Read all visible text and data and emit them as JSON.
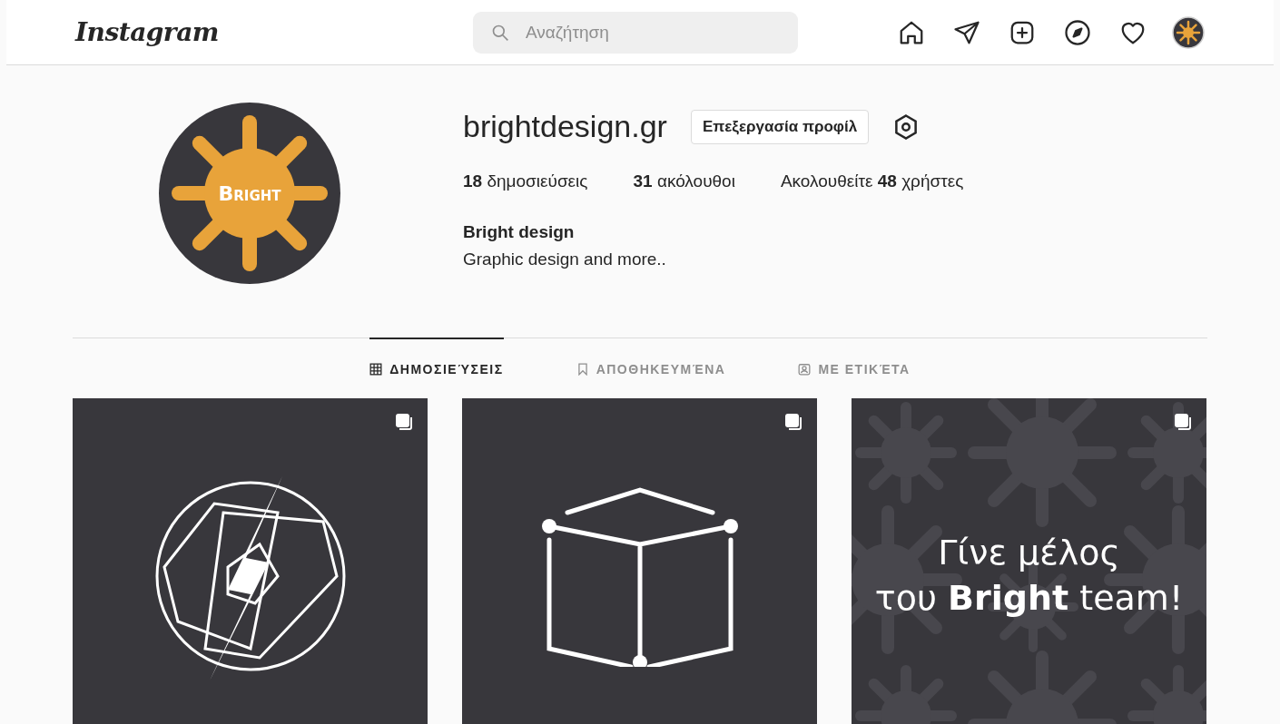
{
  "header": {
    "logo": "Instagram",
    "search": {
      "placeholder": "Αναζήτηση"
    },
    "nav": [
      {
        "kind": "home",
        "selected": false
      },
      {
        "kind": "direct",
        "selected": false
      },
      {
        "kind": "new",
        "selected": false
      },
      {
        "kind": "explore",
        "selected": false
      },
      {
        "kind": "activity",
        "selected": false
      },
      {
        "kind": "avatar",
        "selected": false
      }
    ]
  },
  "profile": {
    "username": "brightdesign.gr",
    "edit_button": "Επεξεργασία προφίλ",
    "avatar_logo": "Bright",
    "stats": [
      {
        "count": "18",
        "label": "δημοσιεύσεις"
      },
      {
        "count": "31",
        "label": "ακόλουθοι"
      },
      {
        "count": "48",
        "label": "χρήστες",
        "prefix": "Ακολουθείτε"
      }
    ],
    "name": "Bright design",
    "bio": "Graphic design and more.."
  },
  "tabs": [
    {
      "kind": "grid",
      "label": "ΔΗΜΟΣΙΕΎΣΕΙΣ",
      "selected": true
    },
    {
      "kind": "saved",
      "label": "ΑΠΟΘΗΚΕΥΜΈΝΑ",
      "selected": false
    },
    {
      "kind": "tagged",
      "label": "ΜΕ ΕΤΙΚΈΤΑ",
      "selected": false
    }
  ],
  "posts": [
    {
      "kind": "fist",
      "multiple": true
    },
    {
      "kind": "cube",
      "multiple": true
    },
    {
      "kind": "text",
      "multiple": true,
      "lines": [
        "Γίνε μέλος",
        "του **Bright** team!"
      ]
    }
  ]
}
